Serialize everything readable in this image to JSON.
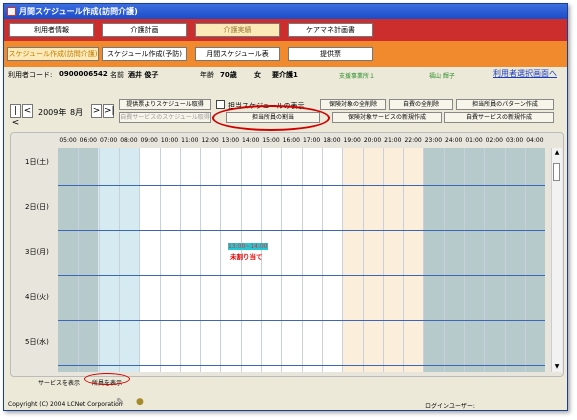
{
  "window": {
    "title": "月間スケジュール作成(訪問介護)"
  },
  "nav": {
    "tabs": [
      {
        "label": "利用者情報",
        "active": false
      },
      {
        "label": "介護計画",
        "active": false
      },
      {
        "label": "介護実績",
        "active": true
      },
      {
        "label": "ケアマネ計画書",
        "active": false
      }
    ],
    "subtabs": [
      {
        "label": "スケジュール作成(訪問介護)",
        "active": true
      },
      {
        "label": "スケジュール作成(予防)",
        "active": false
      },
      {
        "label": "月間スケジュール表",
        "active": false
      },
      {
        "label": "提供票",
        "active": false
      }
    ]
  },
  "user_info": {
    "code_label": "利用者コード:",
    "code": "0900006542",
    "name_label": "名前",
    "name": "酒井 俊子",
    "age_label": "年齢",
    "age": "70歳",
    "gender": "女",
    "care_level": "要介護1",
    "office": "支援事業所１",
    "staff": "福山 輝子",
    "select_link": "利用者選択画面へ"
  },
  "period": {
    "year": "2009年",
    "month": "8月"
  },
  "actions": {
    "get_from_provision": "提供票よりスケジュール取得",
    "get_own_service": "自費サービスのスケジュール取得",
    "show_assigned": "担当スケジュールの表示",
    "assign_staff": "担当所員の割当",
    "delete_insured": "保険対象の全削除",
    "delete_own": "自費の全削除",
    "staff_pattern": "担当所員のパターン作成",
    "new_insured": "保険対象サービスの新規作成",
    "new_own": "自費サービスの新規作成"
  },
  "schedule": {
    "times": [
      "05:00",
      "06:00",
      "07:00",
      "08:00",
      "09:00",
      "10:00",
      "11:00",
      "12:00",
      "13:00",
      "14:00",
      "15:00",
      "16:00",
      "17:00",
      "18:00",
      "19:00",
      "20:00",
      "21:00",
      "22:00",
      "23:00",
      "24:00",
      "01:00",
      "02:00",
      "03:00",
      "04:00"
    ],
    "days": [
      "1日(土)",
      "2日(日)",
      "3日(月)",
      "4日(火)",
      "5日(水)"
    ],
    "entry": {
      "time": "13:00~14:00",
      "status": "未割り当て"
    }
  },
  "footer": {
    "show_service": "サービスを表示",
    "show_staff": "所員を表示",
    "copyright": "Copyright (C) 2004 LCNet Corporation",
    "login_label": "ログインユーザー:"
  }
}
